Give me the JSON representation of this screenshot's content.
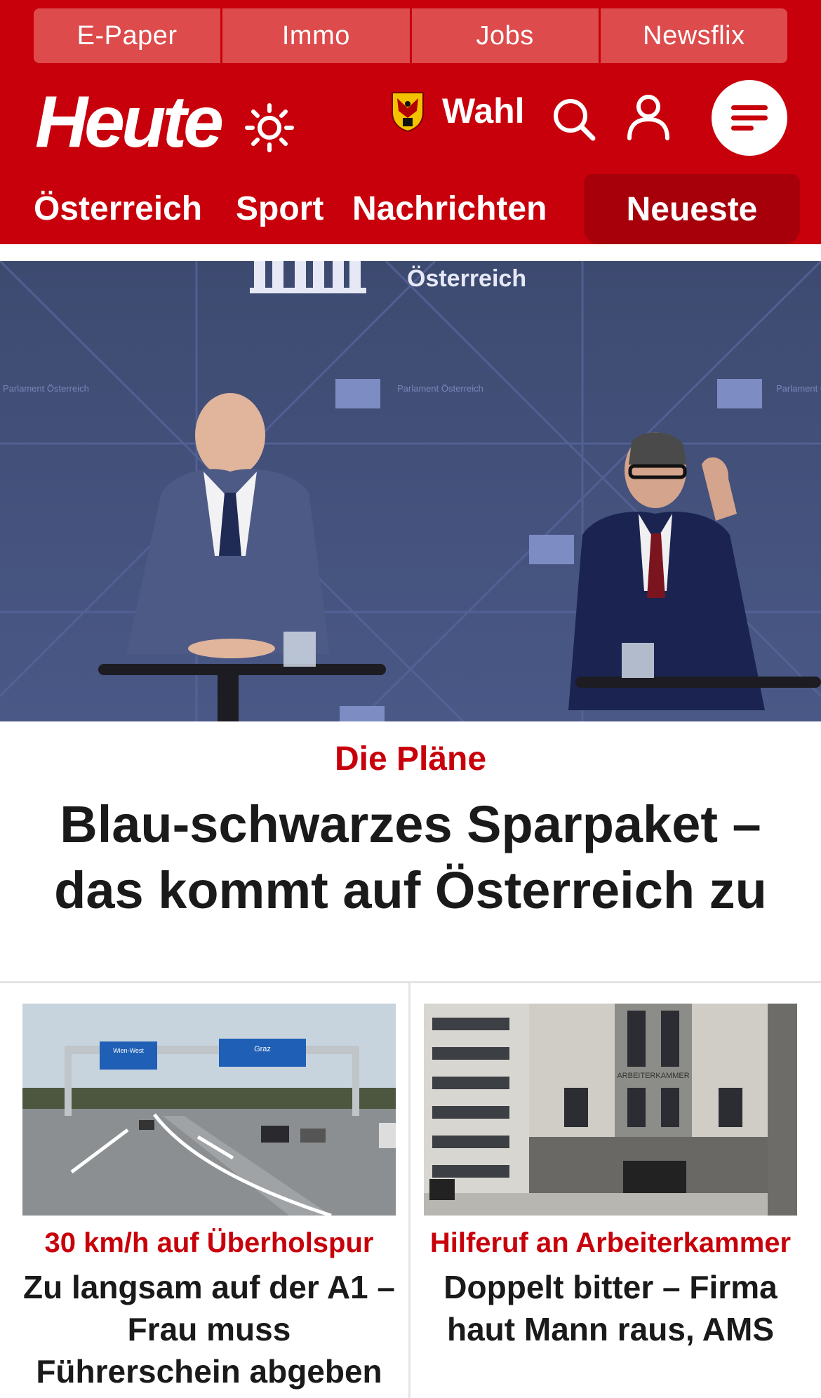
{
  "topbar": {
    "items": [
      "E-Paper",
      "Immo",
      "Jobs",
      "Newsflix"
    ]
  },
  "header": {
    "logo": "Heute",
    "wahl_label": "Wahl",
    "brand_color": "#c8000b",
    "icons": [
      "sun-icon",
      "coat-of-arms-icon",
      "search-icon",
      "user-icon",
      "menu-icon"
    ]
  },
  "nav": {
    "items": [
      "Österreich",
      "Sport",
      "Nachrichten"
    ],
    "active": "Neueste"
  },
  "hero": {
    "backdrop_text": "Österreich",
    "backdrop_small": "Parlament Österreich",
    "kicker": "Die Pläne",
    "headline": "Blau-schwarzes Sparpaket – das kommt auf Österreich zu"
  },
  "cards": [
    {
      "kicker": "30 km/h auf Überholspur",
      "title": "Zu langsam auf der A1 – Frau muss Führerschein abgeben",
      "sign_left": "Wien-West",
      "sign_right": "Graz"
    },
    {
      "kicker": "Hilferuf an Arbeiterkammer",
      "title": "Doppelt bitter – Firma haut Mann raus, AMS",
      "building_sign": "ARBEITERKAMMER"
    }
  ]
}
